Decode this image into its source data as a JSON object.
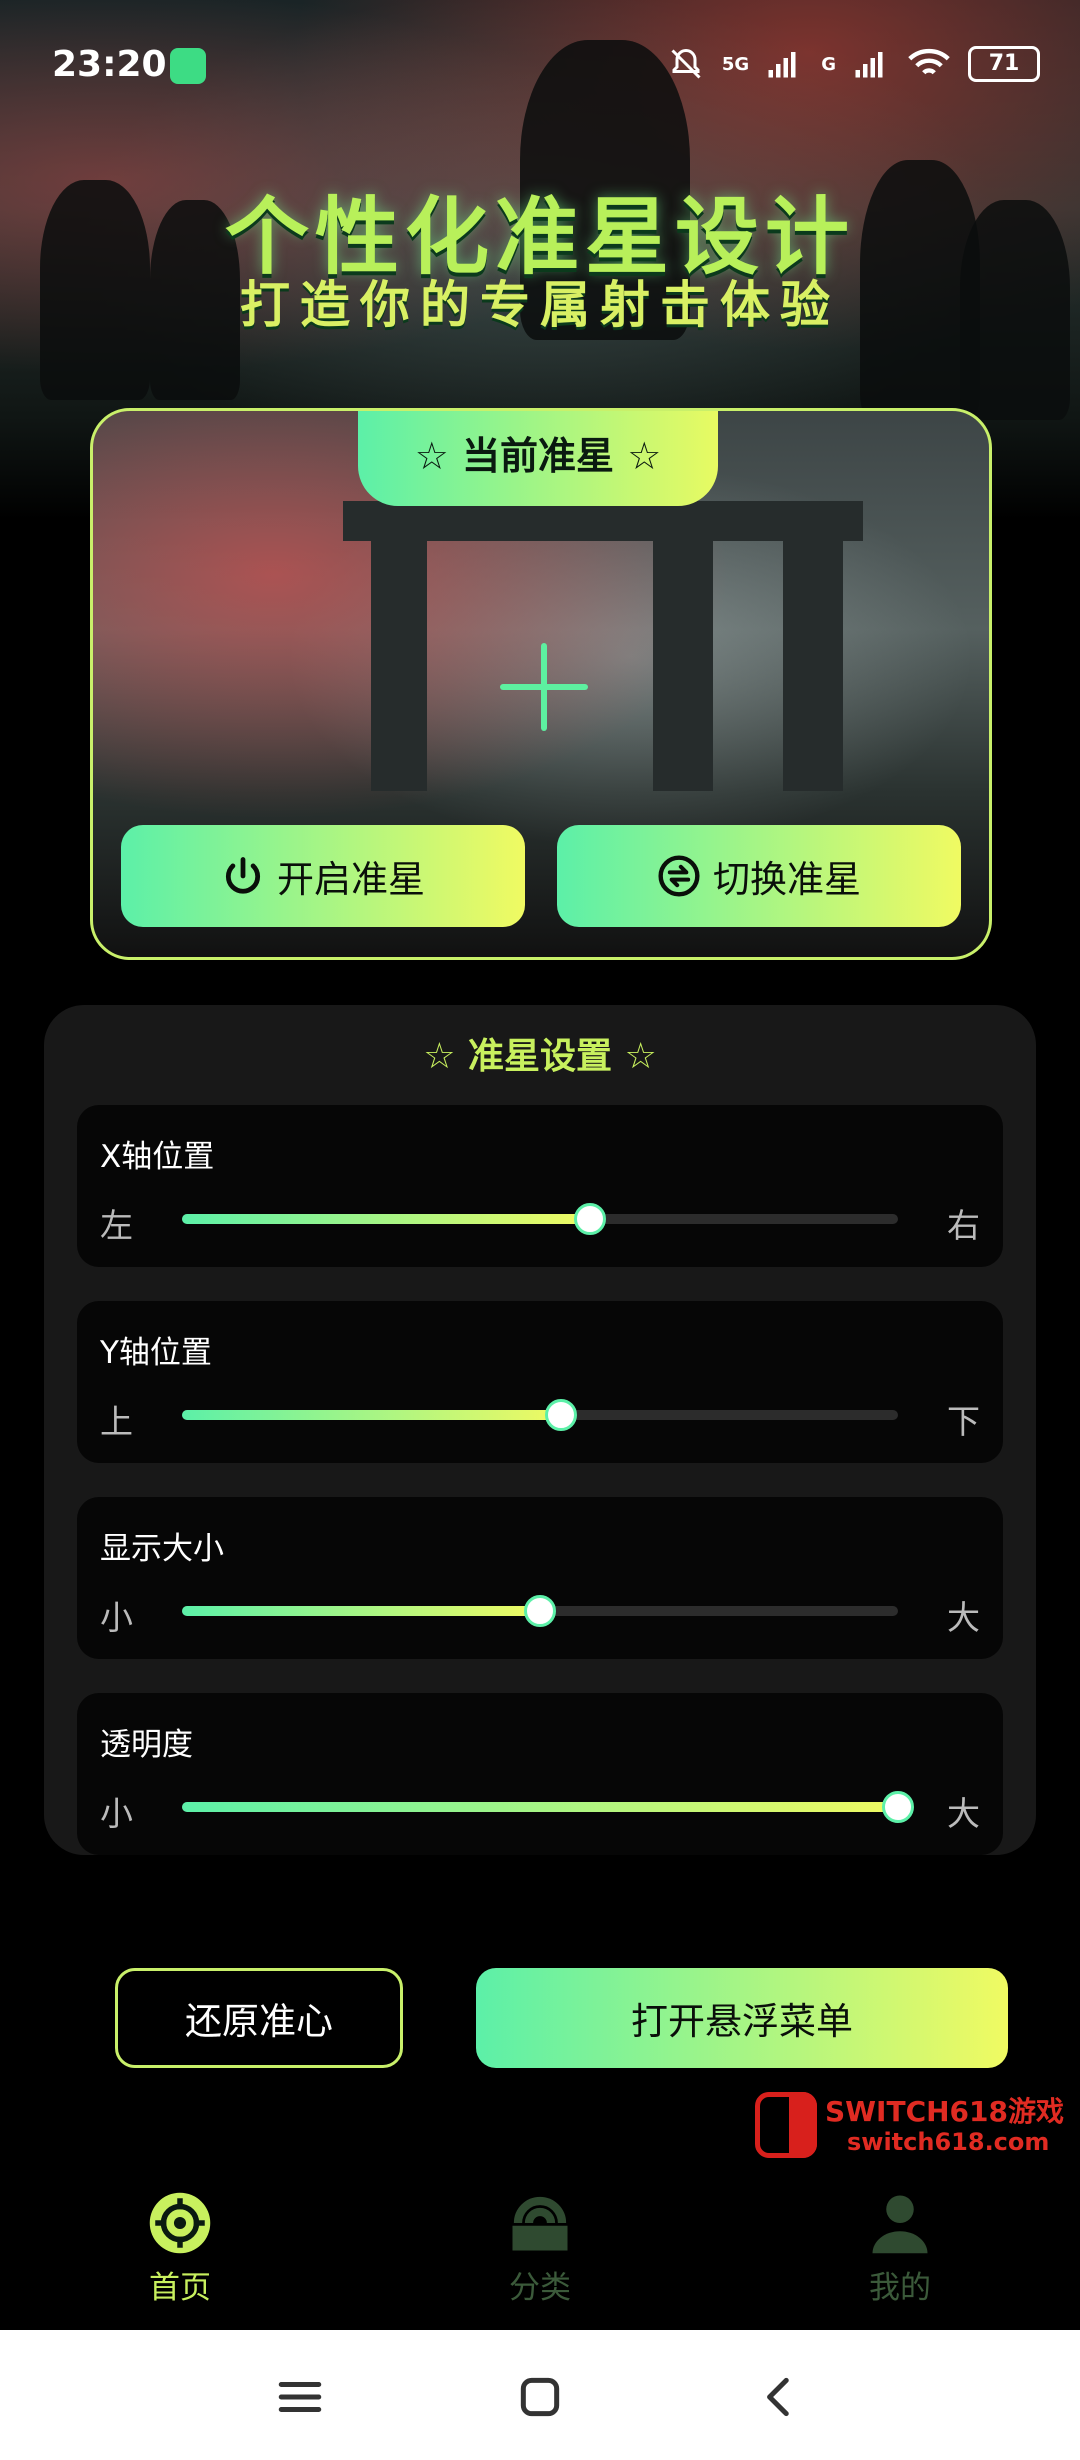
{
  "status_bar": {
    "time": "23:20",
    "network_1": "5G",
    "network_2": "G",
    "battery": "71"
  },
  "hero": {
    "title": "个性化准星设计",
    "subtitle": "打造你的专属射击体验"
  },
  "preview_card": {
    "tab_label": "☆ 当前准星 ☆",
    "enable_button": "开启准星",
    "switch_button": "切换准星",
    "crosshair_color": "#5df0a0"
  },
  "settings": {
    "title": "☆ 准星设置 ☆",
    "sliders": [
      {
        "label": "X轴位置",
        "min_label": "左",
        "max_label": "右",
        "value_fraction": 0.57
      },
      {
        "label": "Y轴位置",
        "min_label": "上",
        "max_label": "下",
        "value_fraction": 0.53
      },
      {
        "label": "显示大小",
        "min_label": "小",
        "max_label": "大",
        "value_fraction": 0.5
      },
      {
        "label": "透明度",
        "min_label": "小",
        "max_label": "大",
        "value_fraction": 1.0
      }
    ]
  },
  "actions": {
    "reset_button": "还原准心",
    "float_menu_button": "打开悬浮菜单"
  },
  "watermark": {
    "line1": "SWITCH618游戏",
    "line2": "switch618.com"
  },
  "tabbar": {
    "items": [
      {
        "label": "首页",
        "icon": "crosshair-icon",
        "active": true
      },
      {
        "label": "分类",
        "icon": "category-icon",
        "active": false
      },
      {
        "label": "我的",
        "icon": "user-icon",
        "active": false
      }
    ]
  },
  "colors": {
    "accent_start": "#5cf0a8",
    "accent_end": "#f0fa62",
    "active_tab": "#c8f05e",
    "inactive_tab": "#3b5a3a"
  }
}
